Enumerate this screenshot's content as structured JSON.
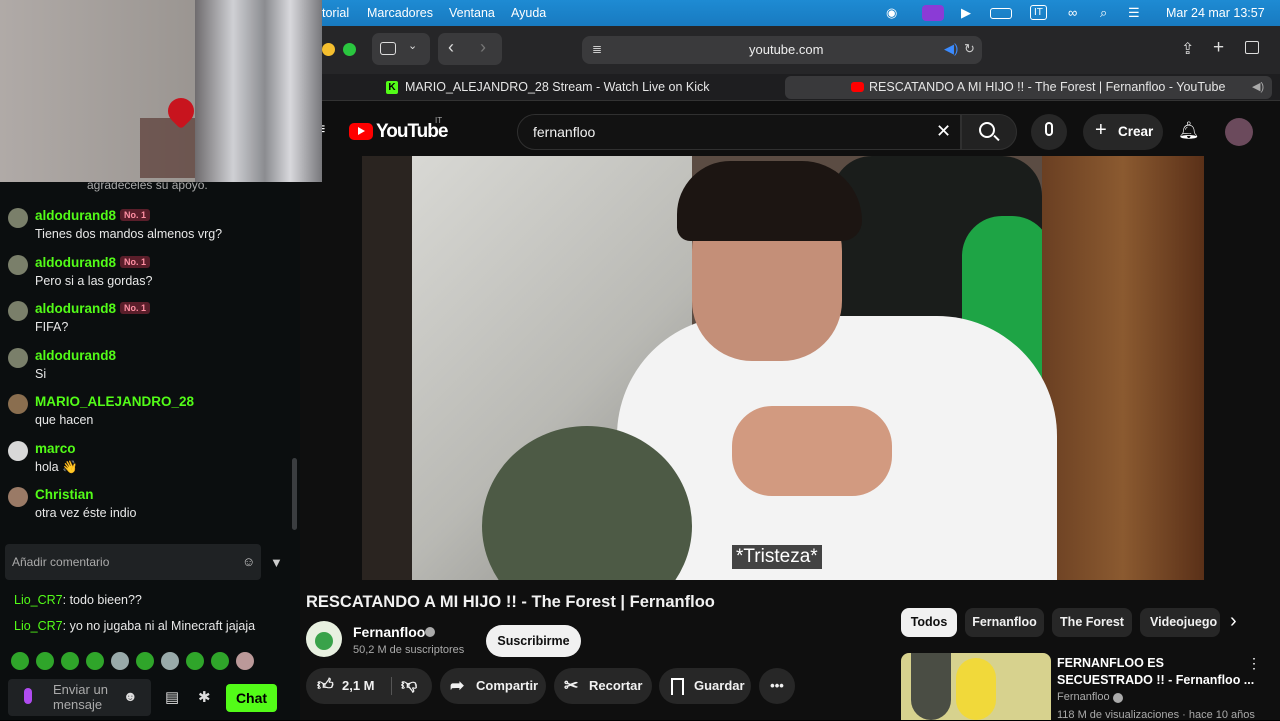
{
  "menubar": {
    "items": [
      "torial",
      "Marcadores",
      "Ventana",
      "Ayuda"
    ],
    "datetime": "Mar 24 mar 13:57",
    "input_source": "IT"
  },
  "chat": {
    "notice": "agradeceles su apoyo.",
    "messages": [
      {
        "user": "aldodurand8",
        "badge": "No. 1",
        "text": "Tienes dos mandos almenos vrg?"
      },
      {
        "user": "aldodurand8",
        "badge": "No. 1",
        "text": "Pero si a las gordas?"
      },
      {
        "user": "aldodurand8",
        "badge": "No. 1",
        "text": "FIFA?"
      },
      {
        "user": "aldodurand8",
        "badge": "",
        "text": "Si"
      },
      {
        "user": "MARIO_ALEJANDRO_28",
        "badge": "",
        "text": "que hacen"
      },
      {
        "user": "marco",
        "badge": "",
        "text": "hola 👋"
      },
      {
        "user": "Christian",
        "badge": "",
        "text": "otra vez éste indio"
      }
    ],
    "comment_placeholder": "Añadir comentario",
    "extra": [
      {
        "user": "Lio_CR7",
        "text": ": todo bieen??"
      },
      {
        "user": "Lio_CR7",
        "text": ": yo no jugaba ni al Minecraft jajaja"
      }
    ],
    "input_placeholder_1": "Enviar un",
    "input_placeholder_2": "mensaje",
    "chat_button": "Chat",
    "colors": {
      "accent": "#53fc18"
    }
  },
  "browser": {
    "url": "youtube.com",
    "tabs": [
      {
        "label": "MARIO_ALEJANDRO_28 Stream - Watch Live on Kick"
      },
      {
        "label": "RESCATANDO A MI HIJO !! - The Forest | Fernanfloo - YouTube"
      }
    ]
  },
  "youtube": {
    "logo": "YouTube",
    "region": "IT",
    "search_value": "fernanfloo",
    "create_label": "Crear",
    "subtitle": "*Tristeza*",
    "video_title": "RESCATANDO A MI HIJO !! - The Forest | Fernanfloo",
    "channel": "Fernanfloo",
    "subscribers": "50,2 M de suscriptores",
    "subscribe_label": "Suscribirme",
    "likes": "2,1 M",
    "share_label": "Compartir",
    "clip_label": "Recortar",
    "save_label": "Guardar",
    "chips": [
      "Todos",
      "Fernanfloo",
      "The Forest",
      "Videojuego"
    ],
    "recommended": {
      "title_1": "FERNANFLOO ES",
      "title_2": "SECUESTRADO !! - Fernanfloo ...",
      "channel": "Fernanfloo",
      "meta": "118 M de visualizaciones · hace 10 años"
    }
  }
}
